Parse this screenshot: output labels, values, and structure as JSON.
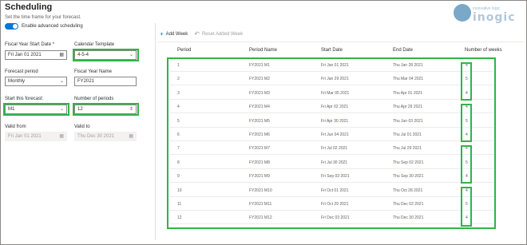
{
  "page": {
    "title": "Scheduling",
    "subtitle": "Set the time frame for your forecast.",
    "toggle_label": "Enable advanced scheduling"
  },
  "logo": {
    "tagline": "innovative logic",
    "brand": "inogic"
  },
  "form": {
    "fiscal_year_start_date": {
      "label": "Fiscal Year Start Date *",
      "value": "Fri Jan 01 2021",
      "icon": "calendar-icon"
    },
    "calendar_template": {
      "label": "Calendar Template",
      "value": "4-5-4",
      "icon": "chevron-down-icon"
    },
    "forecast_period": {
      "label": "Forecast period",
      "value": "Monthly",
      "icon": "chevron-down-icon"
    },
    "fiscal_year_name": {
      "label": "Fiscal Year Name",
      "value": "FY2021"
    },
    "start_this_forecast": {
      "label": "Start this forecast:",
      "value": "M1",
      "icon": "chevron-down-icon"
    },
    "number_of_periods": {
      "label": "Number of periods",
      "value": "12",
      "icon": "spinner-icon"
    },
    "valid_from": {
      "label": "Valid from",
      "value": "Fri Jan 01 2021",
      "icon": "calendar-icon"
    },
    "valid_to": {
      "label": "Valid to",
      "value": "Thu Dec 30 2021",
      "icon": "calendar-icon"
    }
  },
  "toolbar": {
    "add_week_label": "Add Week",
    "reset_label": "Reset Added Week"
  },
  "table": {
    "headers": [
      "Period",
      "Period Name",
      "Start Date",
      "End Date",
      "Number of weeks"
    ],
    "rows": [
      [
        "1",
        "FY2021 M1",
        "Fri Jan 01 2021",
        "Thu Jan 28 2021",
        "4"
      ],
      [
        "2",
        "FY2021 M2",
        "Fri Jan 29 2021",
        "Thu Mar 04 2021",
        "5"
      ],
      [
        "3",
        "FY2021 M3",
        "Fri Mar 05 2021",
        "Thu Apr 01 2021",
        "4"
      ],
      [
        "4",
        "FY2021 M4",
        "Fri Apr 02 2021",
        "Thu Apr 29 2021",
        "4"
      ],
      [
        "5",
        "FY2021 M5",
        "Fri Apr 30 2021",
        "Thu Jun 03 2021",
        "5"
      ],
      [
        "6",
        "FY2021 M6",
        "Fri Jun 04 2021",
        "Thu Jul 01 2021",
        "4"
      ],
      [
        "7",
        "FY2021 M7",
        "Fri Jul 02 2021",
        "Thu Jul 29 2021",
        "4"
      ],
      [
        "8",
        "FY2021 M8",
        "Fri Jul 30 2021",
        "Thu Sep 02 2021",
        "5"
      ],
      [
        "9",
        "FY2021 M9",
        "Fri Sep 03 2021",
        "Thu Sep 30 2021",
        "4"
      ],
      [
        "10",
        "FY2021 M10",
        "Fri Oct 01 2021",
        "Thu Oct 28 2021",
        "4"
      ],
      [
        "11",
        "FY2021 M11",
        "Fri Oct 29 2021",
        "Thu Dec 02 2021",
        "5"
      ],
      [
        "12",
        "FY2021 M12",
        "Fri Dec 03 2021",
        "Thu Dec 30 2021",
        "4"
      ]
    ]
  },
  "colors": {
    "accent": "#0078d4",
    "highlight": "#2fb44a"
  }
}
